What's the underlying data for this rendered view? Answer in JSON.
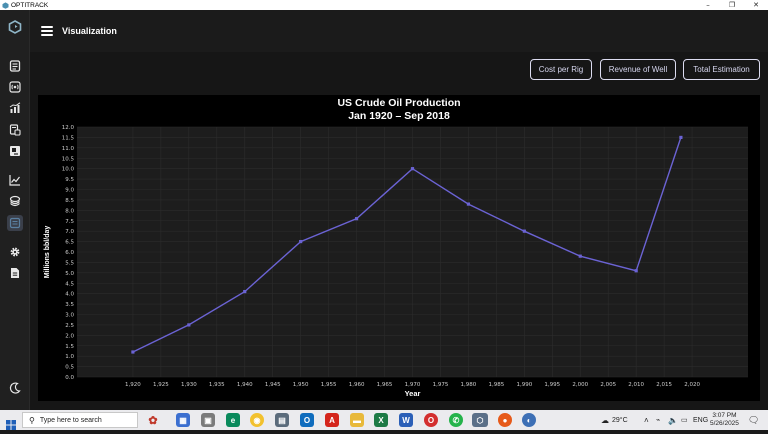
{
  "window": {
    "title": "OPTITRACK"
  },
  "header": {
    "title": "Visualization"
  },
  "toolbar": {
    "cost_per_rig": "Cost per Rig",
    "revenue_of_well": "Revenue of Well",
    "total_estimation": "Total Estimation"
  },
  "sidebar": {
    "items": [
      "logo-icon",
      "report-icon",
      "signal-icon",
      "chart-up-icon",
      "database-icon",
      "export-icon",
      "analytics-icon",
      "layers-icon",
      "dashboard-icon",
      "settings-icon",
      "document-icon",
      "moon-icon"
    ]
  },
  "chart_data": {
    "type": "line",
    "title": "US Crude Oil Production",
    "subtitle": "Jan 1920 – Sep 2018",
    "xlabel": "Year",
    "ylabel": "Millions bbl/day",
    "xlim": [
      1910,
      2030
    ],
    "ylim": [
      0,
      12
    ],
    "xticks": [
      "1,920",
      "1,925",
      "1,930",
      "1,935",
      "1,940",
      "1,945",
      "1,950",
      "1,955",
      "1,960",
      "1,965",
      "1,970",
      "1,975",
      "1,980",
      "1,985",
      "1,990",
      "1,995",
      "2,000",
      "2,005",
      "2,010",
      "2,015",
      "2,020"
    ],
    "yticks": [
      "0.0",
      "0.5",
      "1.0",
      "1.5",
      "2.0",
      "2.5",
      "3.0",
      "3.5",
      "4.0",
      "4.5",
      "5.0",
      "5.5",
      "6.0",
      "6.5",
      "7.0",
      "7.5",
      "8.0",
      "8.5",
      "9.0",
      "9.5",
      "10.0",
      "10.5",
      "11.0",
      "11.5",
      "12.0"
    ],
    "x": [
      1920,
      1930,
      1940,
      1950,
      1960,
      1970,
      1980,
      1990,
      2000,
      2010,
      2018
    ],
    "y": [
      1.2,
      2.5,
      4.1,
      6.5,
      7.6,
      10.0,
      8.3,
      7.0,
      5.8,
      5.1,
      11.5
    ],
    "grid": true,
    "line_color": "#6b63d4",
    "plot_bg": "#1d1d1d"
  },
  "taskbar": {
    "search_placeholder": "Type here to search",
    "weather": "29°C",
    "language": "ENG",
    "time": "3:07 PM",
    "date": "5/26/2025"
  }
}
